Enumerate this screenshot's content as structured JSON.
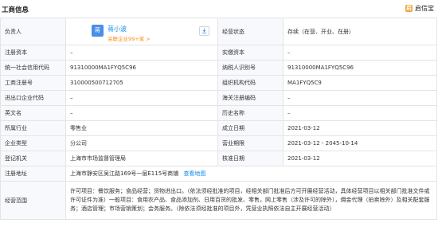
{
  "header": {
    "title": "工商信息",
    "brand_logo": "启",
    "brand_name": "启信宝"
  },
  "owner": {
    "label": "负责人",
    "avatar_char": "蒋",
    "name": "蒋小波",
    "related_link": "关联企业99+家 >",
    "export_icon": "download-icon"
  },
  "rows": {
    "status_label": "经营状态",
    "status_value": "存续（在营、开业、在册）",
    "capital_label": "注册资本",
    "capital_value": "–",
    "paid_label": "实缴资本",
    "paid_value": "–",
    "credit_label": "统一社会信用代码",
    "credit_value": "91310000MA1FYQ5C96",
    "tax_label": "纳税人识别号",
    "tax_value": "91310000MA1FYQ5C96",
    "reg_no_label": "工商注册号",
    "reg_no_value": "310000500712705",
    "org_label": "组织机构代码",
    "org_value": "MA1FYQ5C9",
    "io_label": "进出口企业代码",
    "io_value": "–",
    "customs_label": "海关注册编码",
    "customs_value": "–",
    "en_label": "英文名",
    "en_value": "–",
    "former_label": "历史名称",
    "former_value": "–",
    "industry_label": "所属行业",
    "industry_value": "零售业",
    "founded_label": "成立日期",
    "founded_value": "2021-03-12",
    "type_label": "企业类型",
    "type_value": "分公司",
    "term_label": "营业期限",
    "term_value": "2021-03-12 - 2045-10-14",
    "authority_label": "登记机关",
    "authority_value": "上海市市场监督管理局",
    "approved_label": "核准日期",
    "approved_value": "2021-03-12",
    "address_label": "注册地址",
    "address_value": "上海市静安区吴江路169号一层E115号商铺",
    "map_link": "查看地图",
    "scope_label": "经营范围",
    "scope_value": "许可项目：餐饮服务；食品经营；货物进出口。（依法须经批准的项目，经相关部门批准后方可开展经营活动，具体经营项目以相关部门批准文件或许可证件为准）一般项目：食用农产品、食品添加剂、日用百货的批发、零售，网上零售（涉及许可的除外），佣金代理（拍卖除外）及相关配套服务；酒店管理；市场营销策划；会务服务。（除依法须经批准的项目外，凭营业执照依法自主开展经营活动）"
  }
}
